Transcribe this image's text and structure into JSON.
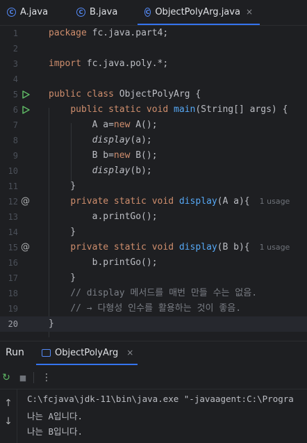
{
  "tabs": [
    {
      "label": "A.java",
      "icon": "java-class-icon"
    },
    {
      "label": "B.java",
      "icon": "java-class-icon"
    },
    {
      "label": "ObjectPolyArg.java",
      "icon": "java-class-icon",
      "active": true
    }
  ],
  "tab_close_glyph": "×",
  "class_glyph": "C",
  "editor": {
    "lines": [
      {
        "n": "1",
        "html": "<span class='kw'>package</span> fc.java.part4;"
      },
      {
        "n": "2",
        "html": ""
      },
      {
        "n": "3",
        "html": "<span class='kw'>import</span> fc.java.poly.*;"
      },
      {
        "n": "4",
        "html": ""
      },
      {
        "n": "5",
        "gutter": "run",
        "html": "<span class='kw'>public class</span> ObjectPolyArg {"
      },
      {
        "n": "6",
        "gutter": "run",
        "html": "    <span class='kw'>public static void</span> <span class='fn'>main</span>(String[] args) {"
      },
      {
        "n": "7",
        "html": "        A a=<span class='kw'>new</span> A();"
      },
      {
        "n": "8",
        "html": "        <span class='it'>display</span>(a);"
      },
      {
        "n": "9",
        "html": "        B b=<span class='kw'>new</span> B();"
      },
      {
        "n": "10",
        "html": "        <span class='it'>display</span>(b);"
      },
      {
        "n": "11",
        "html": "    }"
      },
      {
        "n": "12",
        "gutter": "at",
        "html": "    <span class='kw'>private static void</span> <span class='fn'>display</span>(A a){",
        "hint": "1 usage"
      },
      {
        "n": "13",
        "html": "        a.printGo();"
      },
      {
        "n": "14",
        "html": "    }"
      },
      {
        "n": "15",
        "gutter": "at",
        "html": "    <span class='kw'>private static void</span> <span class='fn'>display</span>(B b){",
        "hint": "1 usage"
      },
      {
        "n": "16",
        "html": "        b.printGo();"
      },
      {
        "n": "17",
        "html": "    }"
      },
      {
        "n": "18",
        "html": "    <span class='cm'>// display 메서드를 매번 만들 수는 없음.</span>"
      },
      {
        "n": "19",
        "html": "    <span class='cm'>// → 다형성 인수를 활용하는 것이 좋음.</span>"
      },
      {
        "n": "20",
        "current": true,
        "html": "}"
      }
    ]
  },
  "run_panel": {
    "title": "Run",
    "tab_label": "ObjectPolyArg",
    "toolbar": [
      {
        "name": "rerun-icon",
        "glyph": "↻"
      },
      {
        "name": "stop-icon",
        "glyph": "■"
      },
      {
        "name": "more-icon",
        "glyph": "⋮"
      }
    ],
    "side_arrows": [
      "↑",
      "↓"
    ],
    "console_lines": [
      "C:\\fcjava\\jdk-11\\bin\\java.exe \"-javaagent:C:\\Progra",
      "나는 A입니다.",
      "나는 B입니다."
    ]
  },
  "colors": {
    "background": "#1e1f22",
    "keyword": "#cf8e6d",
    "function": "#56a8f5",
    "comment": "#7a7e85",
    "accent": "#3574f0",
    "run_gutter": "#5fb865"
  }
}
